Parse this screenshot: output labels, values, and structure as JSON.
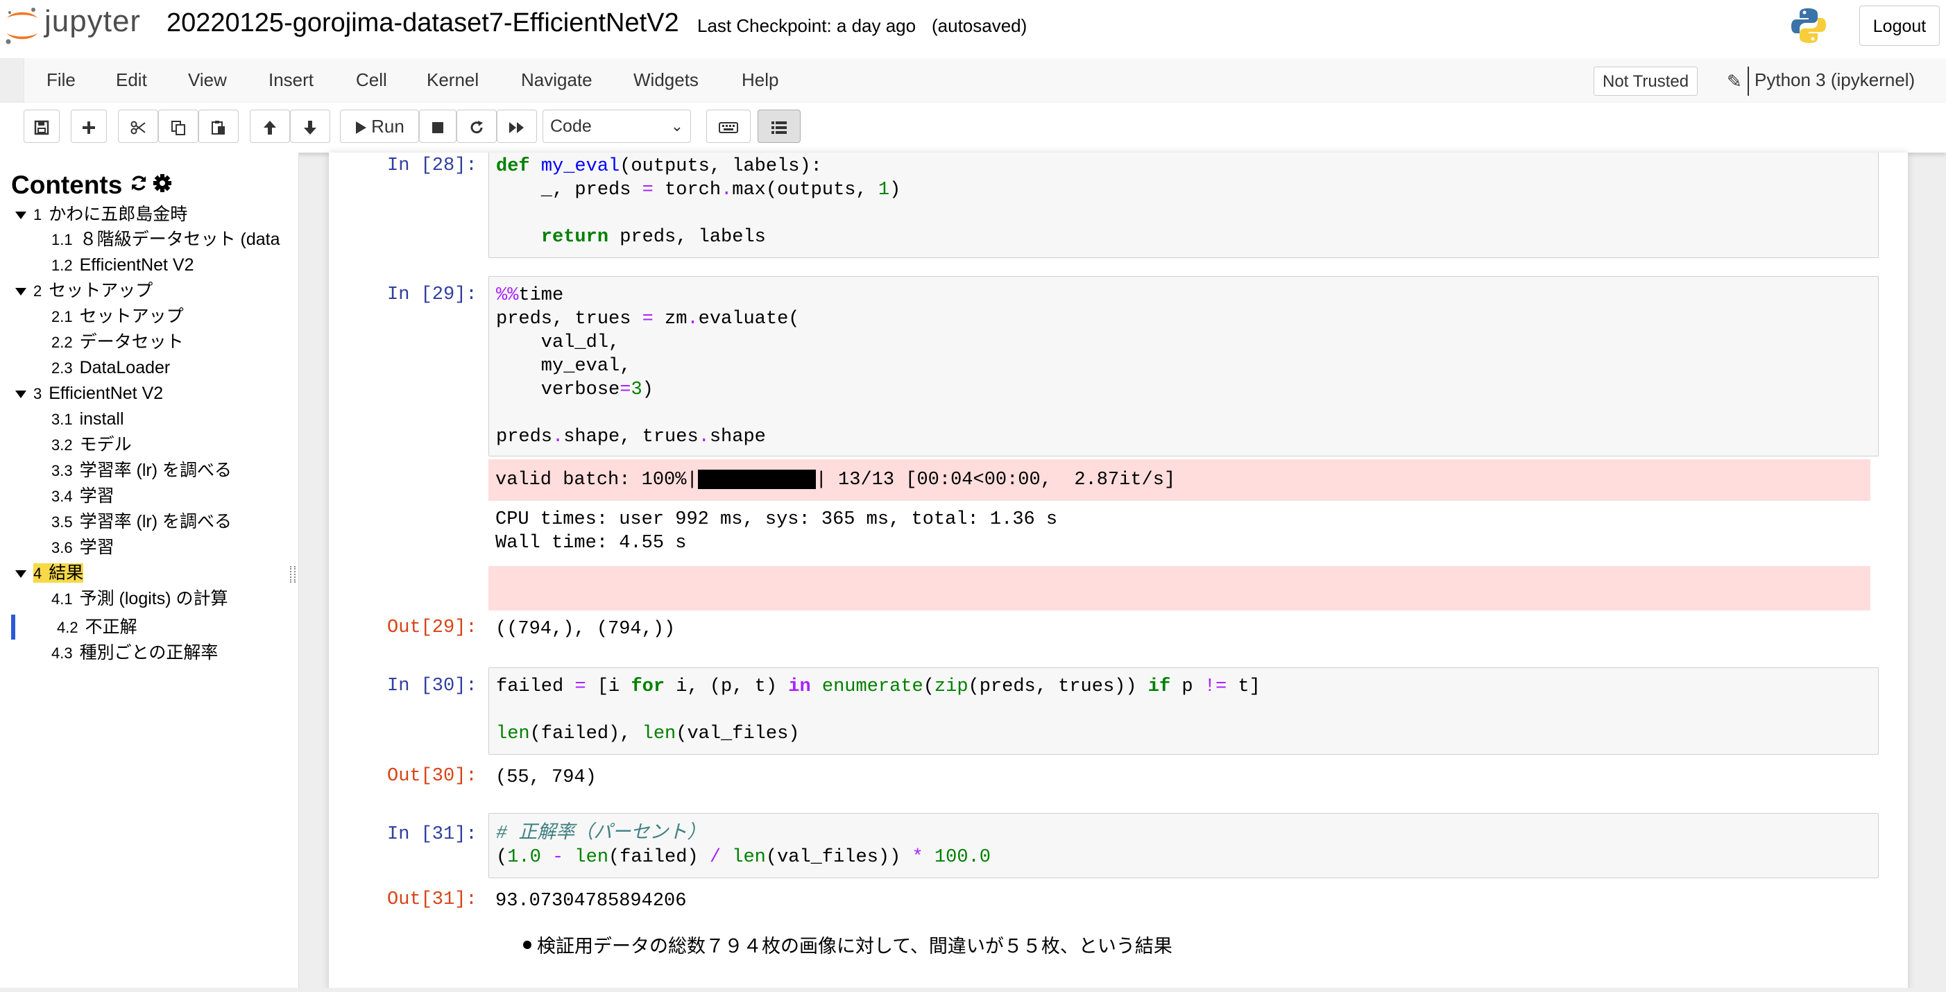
{
  "header": {
    "logo_text": "jupyter",
    "notebook_title": "20220125-gorojima-dataset7-EfficientNetV2",
    "checkpoint": "Last Checkpoint: a day ago",
    "autosave": "(autosaved)",
    "logout_label": "Logout"
  },
  "menubar": {
    "items": [
      "File",
      "Edit",
      "View",
      "Insert",
      "Cell",
      "Kernel",
      "Navigate",
      "Widgets",
      "Help"
    ],
    "trust_label": "Not Trusted",
    "kernel_name": "Python 3 (ipykernel)"
  },
  "toolbar": {
    "run_label": "Run",
    "cell_type": "Code",
    "buttons": [
      "save-icon",
      "plus-icon",
      "scissors-icon",
      "copy-icon",
      "paste-icon",
      "arrow-up-icon",
      "arrow-down-icon",
      "run-icon",
      "stop-icon",
      "restart-icon",
      "fast-forward-icon",
      "keyboard-icon",
      "list-icon"
    ]
  },
  "toc": {
    "title": "Contents",
    "items": [
      {
        "num": "1",
        "label": "かわに五郎島金時"
      },
      {
        "num": "1.1",
        "label": "８階級データセット (data"
      },
      {
        "num": "1.2",
        "label": "EfficientNet V2"
      },
      {
        "num": "2",
        "label": "セットアップ"
      },
      {
        "num": "2.1",
        "label": "セットアップ"
      },
      {
        "num": "2.2",
        "label": "データセット"
      },
      {
        "num": "2.3",
        "label": "DataLoader"
      },
      {
        "num": "3",
        "label": "EfficientNet V2"
      },
      {
        "num": "3.1",
        "label": "install"
      },
      {
        "num": "3.2",
        "label": "モデル"
      },
      {
        "num": "3.3",
        "label": "学習率 (lr) を調べる"
      },
      {
        "num": "3.4",
        "label": "学習"
      },
      {
        "num": "3.5",
        "label": "学習率 (lr) を調べる"
      },
      {
        "num": "3.6",
        "label": "学習"
      },
      {
        "num": "4",
        "label": "結果"
      },
      {
        "num": "4.1",
        "label": "予測 (logits) の計算"
      },
      {
        "num": "4.2",
        "label": "不正解"
      },
      {
        "num": "4.3",
        "label": "種別ごとの正解率"
      }
    ]
  },
  "cells": {
    "c28": {
      "prompt": "In [28]:"
    },
    "c29": {
      "prompt": "In [29]:",
      "progress_prefix": "valid batch: 100%|",
      "progress_suffix": "| 13/13 [00:04<00:00,  2.87it/s]",
      "progress_fraction": 1.0,
      "cpu_times": "CPU times: user 992 ms, sys: 365 ms, total: 1.36 s",
      "wall_time": "Wall time: 4.55 s",
      "out_prompt": "Out[29]:",
      "out_value": "((794,), (794,))"
    },
    "c30": {
      "prompt": "In [30]:",
      "out_prompt": "Out[30]:",
      "out_value": "(55, 794)"
    },
    "c31": {
      "prompt": "In [31]:",
      "out_prompt": "Out[31]:",
      "out_value": "93.07304785894206"
    },
    "markdown_bullet": "検証用データの総数７９４枚の画像に対して、間違いが５５枚、という結果"
  },
  "code_lines": {
    "c28_l1_def": "def",
    "c28_l1_name": "my_eval",
    "c28_l1_rest": "(outputs, labels):",
    "c28_l2_a": "    _, preds ",
    "c28_l2_eq": "=",
    "c28_l2_b": " torch",
    "c28_l2_c": ".",
    "c28_l2_d": "max(outputs, ",
    "c28_l2_num": "1",
    "c28_l2_e": ")",
    "c28_l4_ret": "return",
    "c28_l4_rest": " preds, labels",
    "c29_l1_magic": "%%",
    "c29_l1_rest": "time",
    "c29_l2_a": "preds, trues ",
    "c29_l2_eq": "=",
    "c29_l2_b": " zm",
    "c29_l2_c": ".",
    "c29_l2_d": "evaluate(",
    "c29_l3": "    val_dl,",
    "c29_l4": "    my_eval,",
    "c29_l5_a": "    verbose",
    "c29_l5_eq": "=",
    "c29_l5_num": "3",
    "c29_l5_b": ")",
    "c29_l7_a": "preds",
    "c29_l7_b": ".",
    "c29_l7_c": "shape, trues",
    "c29_l7_d": ".",
    "c29_l7_e": "shape",
    "c30_l1_a": "failed ",
    "c30_l1_eq": "=",
    "c30_l1_b": " [i ",
    "c30_l1_for": "for",
    "c30_l1_c": " i, (p, t) ",
    "c30_l1_in": "in",
    "c30_l1_d": " ",
    "c30_l1_enum": "enumerate",
    "c30_l1_e": "(",
    "c30_l1_zip": "zip",
    "c30_l1_f": "(preds, trues)) ",
    "c30_l1_if": "if",
    "c30_l1_g": " p ",
    "c30_l1_ne": "!=",
    "c30_l1_h": " t]",
    "c30_l3_len1": "len",
    "c30_l3_a": "(failed), ",
    "c30_l3_len2": "len",
    "c30_l3_b": "(val_files)",
    "c31_l1_comment": "# 正解率（パーセント）",
    "c31_l2_a": "(",
    "c31_l2_n1": "1.0",
    "c31_l2_b": " ",
    "c31_l2_minus": "-",
    "c31_l2_c": " ",
    "c31_l2_len1": "len",
    "c31_l2_d": "(failed) ",
    "c31_l2_div": "/",
    "c31_l2_e": " ",
    "c31_l2_len2": "len",
    "c31_l2_f": "(val_files)) ",
    "c31_l2_mul": "*",
    "c31_l2_g": " ",
    "c31_l2_n2": "100.0"
  },
  "colors": {
    "prompt_in": "#303f9f",
    "prompt_out": "#d84315",
    "stderr_bg": "#ffdddd",
    "toc_highlight": "#f7d948",
    "toc_active": "#2a5bd7"
  }
}
